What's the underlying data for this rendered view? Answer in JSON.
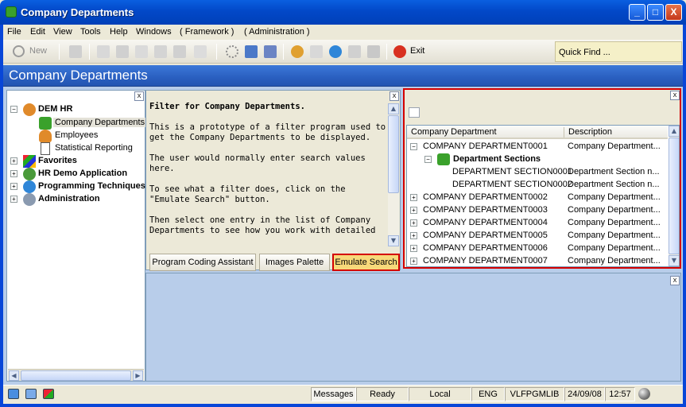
{
  "window": {
    "title": "Company Departments",
    "minimize": "_",
    "maximize": "□",
    "close": "X"
  },
  "menu": [
    "File",
    "Edit",
    "View",
    "Tools",
    "Help",
    "Windows",
    "( Framework )",
    "( Administration )"
  ],
  "toolbar": {
    "new_label": "New",
    "exit_label": "Exit",
    "quickfind": "Quick Find ..."
  },
  "header": {
    "title": "Company Departments"
  },
  "tree": {
    "close": "x",
    "items": [
      {
        "label": "DEM HR",
        "expander": "−",
        "icon": "people-group-icon"
      },
      {
        "label": "Company Departments",
        "icon": "puzzle-icon"
      },
      {
        "label": "Employees",
        "icon": "person-icon"
      },
      {
        "label": "Statistical Reporting",
        "icon": "document-icon"
      },
      {
        "label": "Favorites",
        "expander": "+",
        "icon": "favorites-icon"
      },
      {
        "label": "HR Demo Application",
        "expander": "+",
        "icon": "people-group-icon"
      },
      {
        "label": "Programming Techniques",
        "expander": "+",
        "icon": "gear-icon"
      },
      {
        "label": "Administration",
        "expander": "+",
        "icon": "admin-icon"
      }
    ]
  },
  "filter": {
    "close": "x",
    "title": "Filter for Company Departments.",
    "paragraphs": [
      "This is a prototype of a filter program used to get the Company Departments to be displayed.",
      "The user would normally enter search values here.",
      "To see what a filter does, click on the \"Emulate Search\" button.",
      "Then select one entry in the list of Company Departments to see how you work with detailed"
    ],
    "buttons": {
      "coding_assistant": "Program Coding Assistant",
      "images_palette": "Images Palette",
      "emulate_search": "Emulate Search"
    }
  },
  "grid": {
    "close": "x",
    "columns": [
      "Company Department",
      "Description"
    ],
    "rows": [
      {
        "dept": "COMPANY DEPARTMENT0001",
        "desc": "Company Department...",
        "expander": "−"
      },
      {
        "dept": "Department Sections",
        "desc": "",
        "expander": "−",
        "group": true
      },
      {
        "dept": "DEPARTMENT SECTION0001",
        "desc": "Department Section n..."
      },
      {
        "dept": "DEPARTMENT SECTION0002",
        "desc": "Department Section n..."
      },
      {
        "dept": "COMPANY DEPARTMENT0002",
        "desc": "Company Department...",
        "expander": "+"
      },
      {
        "dept": "COMPANY DEPARTMENT0003",
        "desc": "Company Department...",
        "expander": "+"
      },
      {
        "dept": "COMPANY DEPARTMENT0004",
        "desc": "Company Department...",
        "expander": "+"
      },
      {
        "dept": "COMPANY DEPARTMENT0005",
        "desc": "Company Department...",
        "expander": "+"
      },
      {
        "dept": "COMPANY DEPARTMENT0006",
        "desc": "Company Department...",
        "expander": "+"
      },
      {
        "dept": "COMPANY DEPARTMENT0007",
        "desc": "Company Department...",
        "expander": "+"
      }
    ]
  },
  "bottom": {
    "close": "x"
  },
  "status": {
    "messages": "Messages",
    "state": "Ready",
    "location": "Local",
    "lang": "ENG",
    "library": "VLFPGMLIB",
    "date": "24/09/08",
    "time": "12:57"
  },
  "colors": {
    "accent": "#2A5FC0",
    "highlight": "#D40000",
    "emulate_bg": "#F7D97A"
  }
}
